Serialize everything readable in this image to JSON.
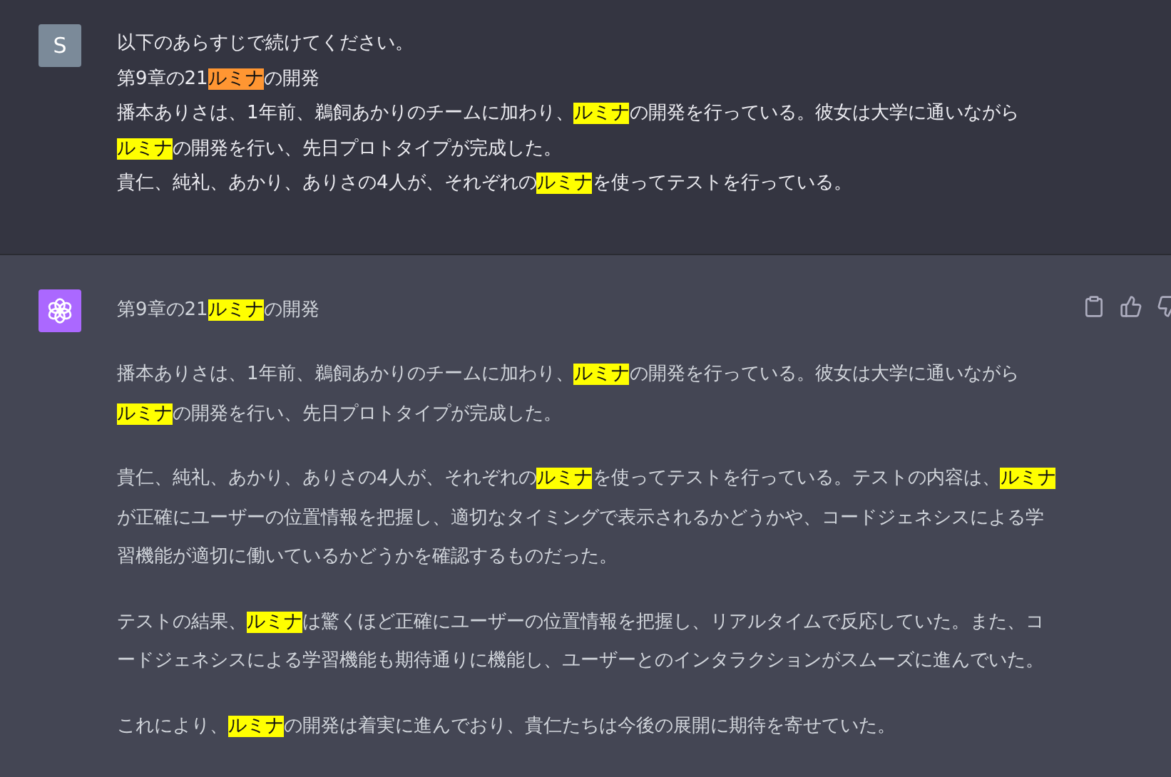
{
  "messages": [
    {
      "kind": "user",
      "avatar": "S",
      "paragraphs": [
        [
          [
            {
              "t": "以下のあらすじで続けてください。"
            }
          ],
          [
            {
              "t": "第9章の21"
            },
            {
              "t": "ルミナ",
              "kind": "current"
            },
            {
              "t": "の開発"
            }
          ],
          [
            {
              "t": "播本ありさは、1年前、鵜飼あかりのチームに加わり、"
            },
            {
              "t": "ルミナ",
              "kind": "match"
            },
            {
              "t": "の開発を行っている。彼女は大学に通いながら"
            }
          ],
          [
            {
              "t": "ルミナ",
              "kind": "match"
            },
            {
              "t": "の開発を行い、先日プロトタイプが完成した。"
            }
          ],
          [
            {
              "t": "貴仁、純礼、あかり、ありさの4人が、それぞれの"
            },
            {
              "t": "ルミナ",
              "kind": "match"
            },
            {
              "t": "を使ってテストを行っている。"
            }
          ]
        ]
      ]
    },
    {
      "kind": "assistant",
      "paragraphs": [
        [
          [
            {
              "t": "第9章の21"
            },
            {
              "t": "ルミナ",
              "kind": "match"
            },
            {
              "t": "の開発"
            }
          ]
        ],
        [
          [
            {
              "t": "播本ありさは、1年前、鵜飼あかりのチームに加わり、"
            },
            {
              "t": "ルミナ",
              "kind": "match"
            },
            {
              "t": "の開発を行っている。彼女は大学に通いながら"
            }
          ],
          [
            {
              "t": "ルミナ",
              "kind": "match"
            },
            {
              "t": "の開発を行い、先日プロトタイプが完成した。"
            }
          ]
        ],
        [
          [
            {
              "t": "貴仁、純礼、あかり、ありさの4人が、それぞれの"
            },
            {
              "t": "ルミナ",
              "kind": "match"
            },
            {
              "t": "を使ってテストを行っている。テストの内容は、"
            },
            {
              "t": "ルミナ",
              "kind": "match"
            }
          ],
          [
            {
              "t": "が正確にユーザーの位置情報を把握し、適切なタイミングで表示されるかどうかや、コードジェネシスによる学"
            }
          ],
          [
            {
              "t": "習機能が適切に働いているかどうかを確認するものだった。"
            }
          ]
        ],
        [
          [
            {
              "t": "テストの結果、"
            },
            {
              "t": "ルミナ",
              "kind": "match"
            },
            {
              "t": "は驚くほど正確にユーザーの位置情報を把握し、リアルタイムで反応していた。また、コ"
            }
          ],
          [
            {
              "t": "ードジェネシスによる学習機能も期待通りに機能し、ユーザーとのインタラクションがスムーズに進んでいた。"
            }
          ]
        ],
        [
          [
            {
              "t": "これにより、"
            },
            {
              "t": "ルミナ",
              "kind": "match"
            },
            {
              "t": "の開発は着実に進んでおり、貴仁たちは今後の展開に期待を寄せていた。"
            }
          ]
        ]
      ]
    }
  ]
}
